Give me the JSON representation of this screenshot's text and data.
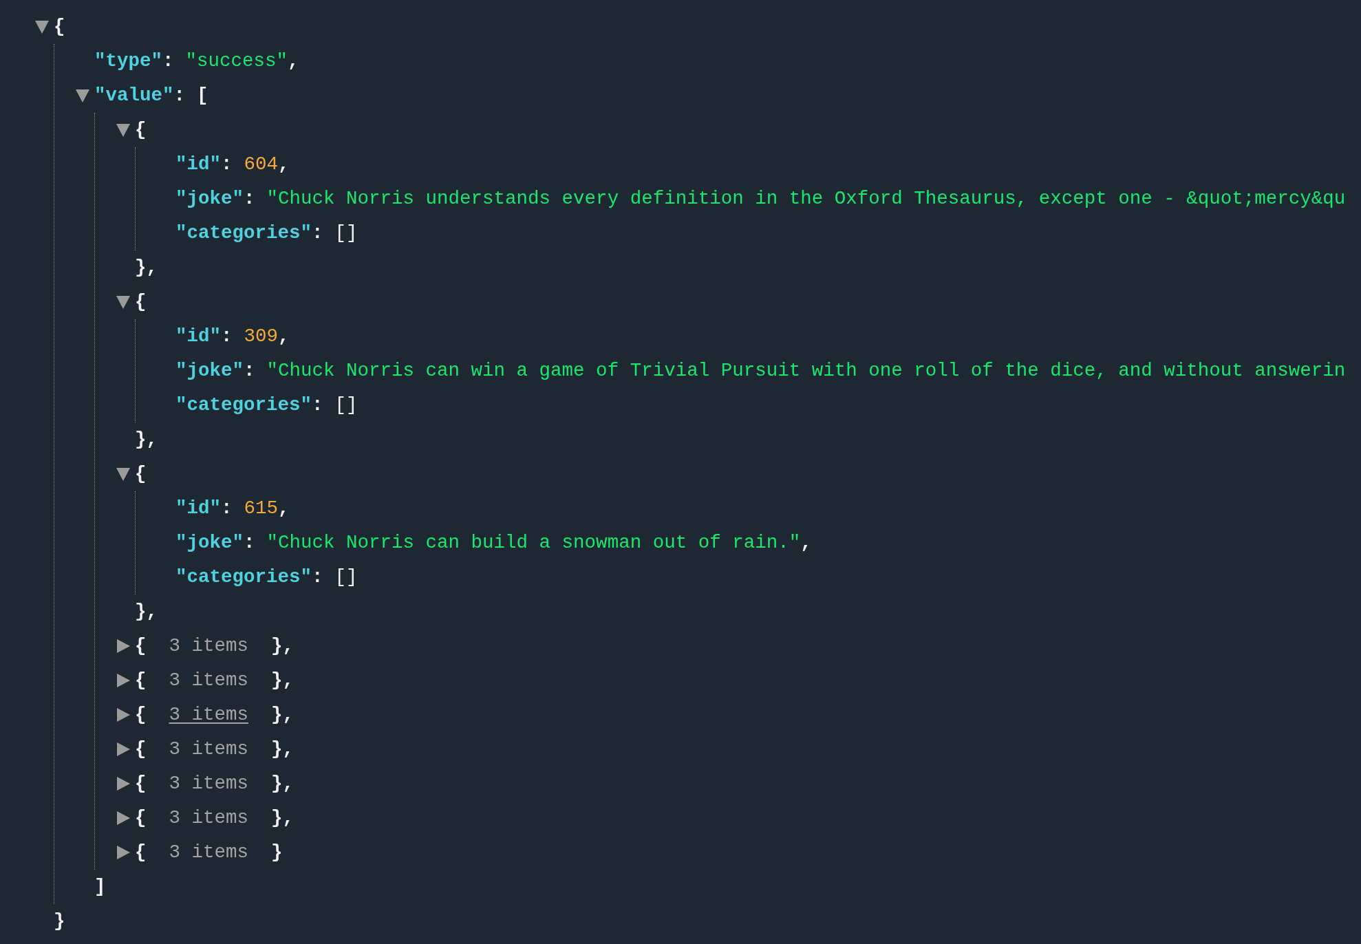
{
  "root": {
    "open": "{",
    "expanded": true,
    "close": "}",
    "children": [
      {
        "key": "\"type\"",
        "colon": ":",
        "value": "\"success\"",
        "kind": "string",
        "comma": ","
      },
      {
        "key": "\"value\"",
        "colon": ":",
        "open": "[",
        "expanded": true,
        "close": "]",
        "children": [
          {
            "open": "{",
            "expanded": true,
            "close": "}",
            "comma": ",",
            "children": [
              {
                "key": "\"id\"",
                "colon": ":",
                "value": "604",
                "kind": "number",
                "comma": ","
              },
              {
                "key": "\"joke\"",
                "colon": ":",
                "value": "\"Chuck Norris understands every definition in the Oxford Thesaurus, except one - &quot;mercy&qu",
                "kind": "string"
              },
              {
                "key": "\"categories\"",
                "colon": ":",
                "value": "[]",
                "kind": "array"
              }
            ]
          },
          {
            "open": "{",
            "expanded": true,
            "close": "}",
            "comma": ",",
            "children": [
              {
                "key": "\"id\"",
                "colon": ":",
                "value": "309",
                "kind": "number",
                "comma": ","
              },
              {
                "key": "\"joke\"",
                "colon": ":",
                "value": "\"Chuck Norris can win a game of Trivial Pursuit with one roll of the dice, and without answerin",
                "kind": "string"
              },
              {
                "key": "\"categories\"",
                "colon": ":",
                "value": "[]",
                "kind": "array"
              }
            ]
          },
          {
            "open": "{",
            "expanded": true,
            "close": "}",
            "comma": ",",
            "children": [
              {
                "key": "\"id\"",
                "colon": ":",
                "value": "615",
                "kind": "number",
                "comma": ","
              },
              {
                "key": "\"joke\"",
                "colon": ":",
                "value": "\"Chuck Norris can build a snowman out of rain.\"",
                "kind": "string",
                "comma": ","
              },
              {
                "key": "\"categories\"",
                "colon": ":",
                "value": "[]",
                "kind": "array"
              }
            ]
          },
          {
            "open": "{",
            "expanded": false,
            "summary": "3 items",
            "hovered": false,
            "close": "}",
            "comma": ","
          },
          {
            "open": "{",
            "expanded": false,
            "summary": "3 items",
            "hovered": false,
            "close": "}",
            "comma": ","
          },
          {
            "open": "{",
            "expanded": false,
            "summary": "3 items",
            "hovered": true,
            "close": "}",
            "comma": ","
          },
          {
            "open": "{",
            "expanded": false,
            "summary": "3 items",
            "hovered": false,
            "close": "}",
            "comma": ","
          },
          {
            "open": "{",
            "expanded": false,
            "summary": "3 items",
            "hovered": false,
            "close": "}",
            "comma": ","
          },
          {
            "open": "{",
            "expanded": false,
            "summary": "3 items",
            "hovered": false,
            "close": "}",
            "comma": ","
          },
          {
            "open": "{",
            "expanded": false,
            "summary": "3 items",
            "hovered": false,
            "close": "}"
          }
        ]
      }
    ]
  }
}
